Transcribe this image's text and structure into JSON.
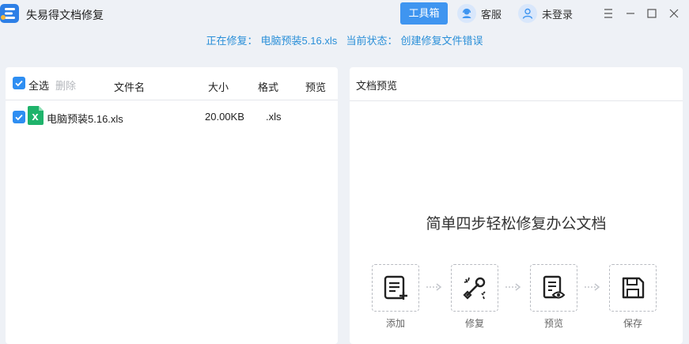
{
  "window": {
    "title": "失易得文档修复",
    "toolbox_label": "工具箱",
    "service_label": "客服",
    "login_label": "未登录"
  },
  "status": {
    "repairing_label": "正在修复：",
    "repairing_file": "电脑预装5.16.xls",
    "state_label": "当前状态：",
    "state_value": "创建修复文件错误"
  },
  "file_list": {
    "select_all_label": "全选",
    "delete_label": "删除",
    "columns": {
      "name": "文件名",
      "size": "大小",
      "format": "格式",
      "preview": "预览"
    },
    "rows": [
      {
        "name": "电脑预装5.16.xls",
        "size": "20.00KB",
        "format": ".xls",
        "checked": true,
        "icon": "excel-file-icon"
      }
    ]
  },
  "preview": {
    "title": "文档预览",
    "heading": "简单四步轻松修复办公文档",
    "steps": [
      {
        "label": "添加",
        "icon": "add-document-icon"
      },
      {
        "label": "修复",
        "icon": "repair-tools-icon"
      },
      {
        "label": "预览",
        "icon": "preview-document-icon"
      },
      {
        "label": "保存",
        "icon": "save-floppy-icon"
      }
    ]
  },
  "colors": {
    "accent": "#3f95f0",
    "status_text": "#2a8fd8",
    "checkbox": "#2e8ef2",
    "excel": "#1fb36b"
  }
}
